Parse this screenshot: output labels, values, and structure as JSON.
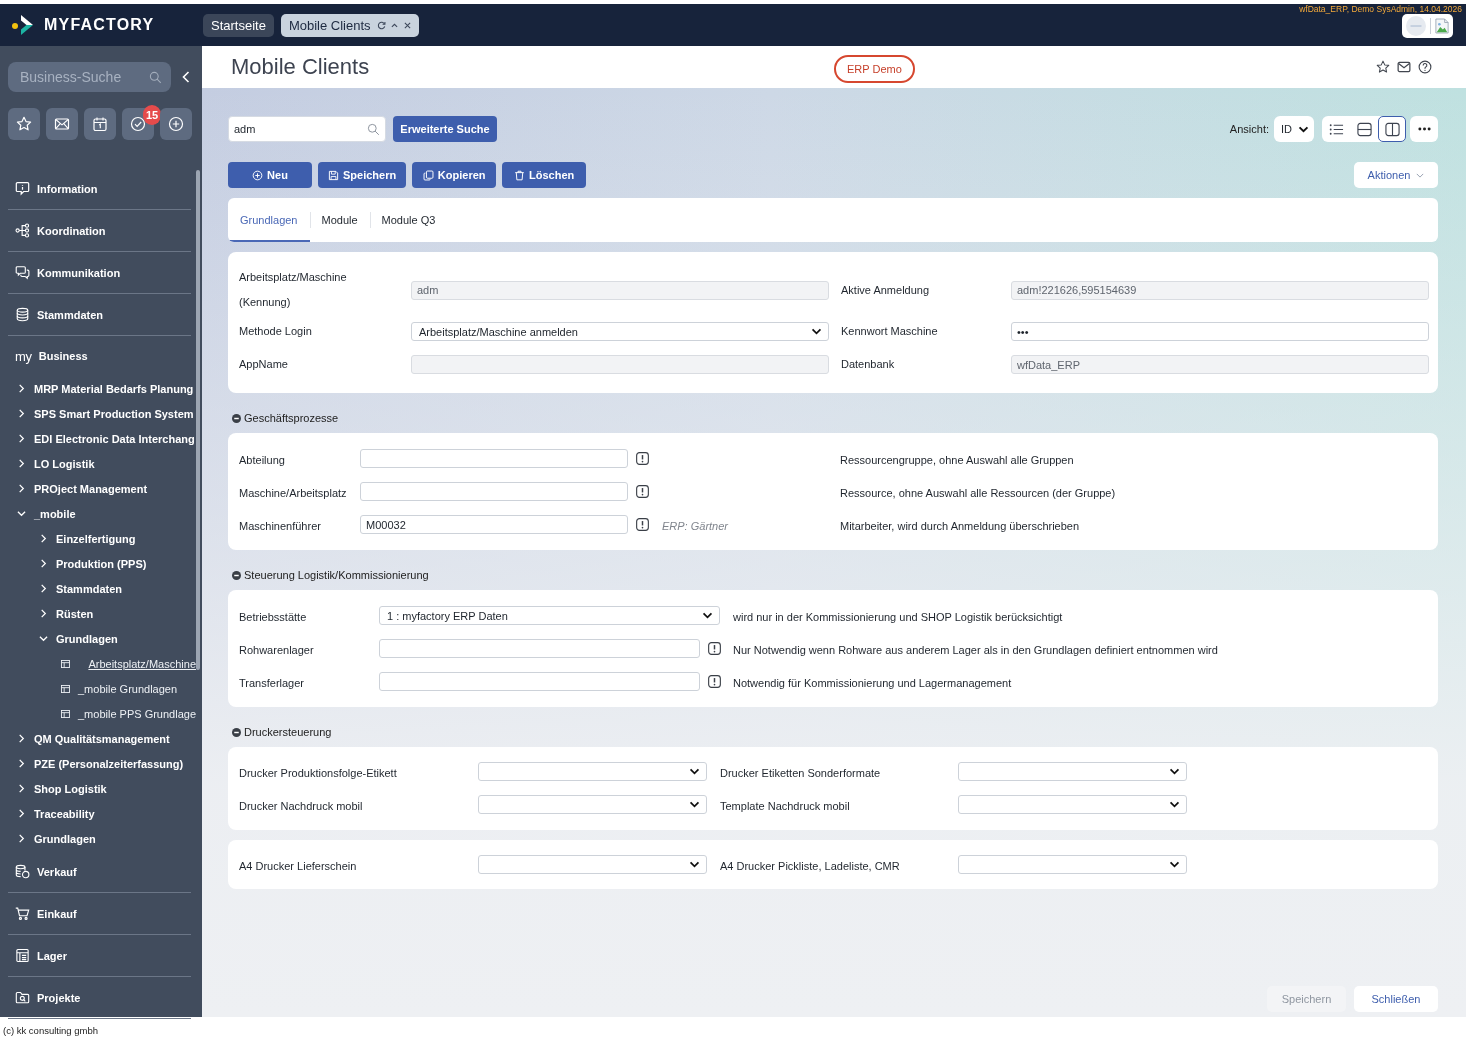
{
  "header": {
    "logo": "MYFACTORY",
    "tabs": [
      {
        "label": "Startseite",
        "selected": false
      },
      {
        "label": "Mobile Clients",
        "selected": true
      }
    ],
    "session_info": "wfData_ERP, Demo SysAdmin, 14.04.2026"
  },
  "sidebar": {
    "search": {
      "placeholder": "Business-Suche"
    },
    "quick_buttons": [
      {
        "kind": "favorites"
      },
      {
        "kind": "mail"
      },
      {
        "kind": "calendar"
      },
      {
        "kind": "tasks",
        "badge": "15"
      },
      {
        "kind": "add"
      }
    ],
    "menu": [
      {
        "kind": "information",
        "label": "Information"
      },
      {
        "kind": "coordination",
        "label": "Koordination"
      },
      {
        "kind": "communication",
        "label": "Kommunikation"
      },
      {
        "kind": "masterdata",
        "label": "Stammdaten"
      },
      {
        "kind": "business",
        "prefix": "my",
        "label": "Business",
        "children": [
          {
            "kind": "folder",
            "label": "MRP Material Bedarfs Planung",
            "expanded": false
          },
          {
            "kind": "folder",
            "label": "SPS Smart Production System",
            "expanded": false
          },
          {
            "kind": "folder",
            "label": "EDI Electronic Data Interchang",
            "expanded": false
          },
          {
            "kind": "folder",
            "label": "LO Logistik",
            "expanded": false
          },
          {
            "kind": "folder",
            "label": "PROject Management",
            "expanded": false
          },
          {
            "kind": "folder",
            "label": "_mobile",
            "expanded": true,
            "children": [
              {
                "kind": "folder",
                "label": "Einzelfertigung",
                "expanded": false
              },
              {
                "kind": "folder",
                "label": "Produktion (PPS)",
                "expanded": false
              },
              {
                "kind": "folder",
                "label": "Stammdaten",
                "expanded": false
              },
              {
                "kind": "folder",
                "label": "Rüsten",
                "expanded": false
              },
              {
                "kind": "folder",
                "label": "Grundlagen",
                "expanded": true,
                "children": [
                  {
                    "kind": "page",
                    "label": "Arbeitsplatz/Maschine",
                    "selected": true
                  },
                  {
                    "kind": "page",
                    "label": "_mobile Grundlagen",
                    "selected": false
                  },
                  {
                    "kind": "page",
                    "label": "_mobile PPS Grundlage",
                    "selected": false
                  }
                ]
              }
            ]
          },
          {
            "kind": "folder",
            "label": "QM Qualitätsmanagement",
            "expanded": false
          },
          {
            "kind": "folder",
            "label": "PZE (Personalzeiterfassung)",
            "expanded": false
          },
          {
            "kind": "folder",
            "label": "Shop Logistik",
            "expanded": false
          },
          {
            "kind": "folder",
            "label": "Traceability",
            "expanded": false
          },
          {
            "kind": "folder",
            "label": "Grundlagen",
            "expanded": false
          }
        ]
      },
      {
        "kind": "sales",
        "label": "Verkauf"
      },
      {
        "kind": "purchasing",
        "label": "Einkauf"
      },
      {
        "kind": "warehouse",
        "label": "Lager"
      },
      {
        "kind": "projects",
        "label": "Projekte"
      }
    ]
  },
  "page": {
    "title": "Mobile Clients",
    "badge": "ERP Demo",
    "title_tools": [
      {
        "kind": "favorite"
      },
      {
        "kind": "mail"
      },
      {
        "kind": "help"
      }
    ],
    "search": {
      "value": "adm"
    },
    "search_button": "Erweiterte Suche",
    "view": {
      "label": "Ansicht:",
      "value": "ID",
      "modes": [
        {
          "kind": "list",
          "selected": false
        },
        {
          "kind": "rows",
          "selected": false
        },
        {
          "kind": "columns",
          "selected": true
        }
      ]
    },
    "actions": [
      {
        "kind": "new",
        "label": "Neu"
      },
      {
        "kind": "save",
        "label": "Speichern"
      },
      {
        "kind": "copy",
        "label": "Kopieren"
      },
      {
        "kind": "delete",
        "label": "Löschen"
      }
    ],
    "actions_menu": "Aktionen",
    "tabs": [
      {
        "label": "Grundlagen",
        "selected": true
      },
      {
        "label": "Module",
        "selected": false
      },
      {
        "label": "Module Q3",
        "selected": false
      }
    ],
    "general_fields": [
      {
        "label": "Arbeitsplatz/Maschine (Kennung)",
        "kind": "readonly",
        "value": "adm"
      },
      {
        "label": "Aktive Anmeldung",
        "kind": "readonly",
        "value": "adm!221626,595154639"
      },
      {
        "label": "Methode Login",
        "kind": "select",
        "value": "Arbeitsplatz/Maschine anmelden"
      },
      {
        "label": "Kennwort Maschine",
        "kind": "password",
        "value": "•••"
      },
      {
        "label": "AppName",
        "kind": "readonly"
      },
      {
        "label": "Datenbank",
        "kind": "readonly",
        "value": "wfData_ERP"
      }
    ],
    "sections": [
      {
        "title": "Geschäftsprozesse",
        "expanded": true,
        "kind": "notes",
        "rows": [
          {
            "label": "Abteilung",
            "kind": "lookup",
            "description": "Ressourcengruppe, ohne Auswahl alle Gruppen"
          },
          {
            "label": "Maschine/Arbeitsplatz",
            "kind": "lookup",
            "description": "Ressource, ohne Auswahl alle Ressourcen (der Gruppe)"
          },
          {
            "label": "Maschinenführer",
            "kind": "lookup",
            "value": "M00032",
            "note": "ERP: Gärtner",
            "description": "Mitarbeiter, wird durch Anmeldung überschrieben"
          }
        ]
      },
      {
        "title": "Steuerung Logistik/Kommissionierung",
        "expanded": true,
        "kind": "inline",
        "rows": [
          {
            "label": "Betriebsstätte",
            "kind": "select",
            "value": "1 : myfactory ERP Daten",
            "description": "wird nur in der Kommissionierung und SHOP Logistik berücksichtigt"
          },
          {
            "label": "Rohwarenlager",
            "kind": "lookup",
            "description": "Nur Notwendig wenn Rohware aus anderem Lager als in den Grundlagen definiert entnommen wird"
          },
          {
            "label": "Transferlager",
            "kind": "lookup",
            "description": "Notwendig für Kommissionierung und Lagermanagement"
          }
        ]
      },
      {
        "title": "Druckersteuerung",
        "expanded": true,
        "kind": "pairs",
        "cards": [
          {
            "fields": [
              {
                "label": "Drucker Produktionsfolge-Etikett",
                "kind": "select"
              },
              {
                "label": "Drucker Etiketten Sonderformate",
                "kind": "select"
              },
              {
                "label": "Drucker Nachdruck mobil",
                "kind": "select"
              },
              {
                "label": "Template Nachdruck mobil",
                "kind": "select"
              }
            ]
          },
          {
            "fields": [
              {
                "label": "A4 Drucker Lieferschein",
                "kind": "select"
              },
              {
                "label": "A4 Drucker Pickliste, Ladeliste, CMR",
                "kind": "select"
              }
            ]
          }
        ]
      }
    ],
    "footer_buttons": [
      {
        "label": "Speichern",
        "disabled": true
      },
      {
        "label": "Schließen",
        "disabled": false
      }
    ]
  },
  "copyright": "(c) kk consulting gmbh"
}
